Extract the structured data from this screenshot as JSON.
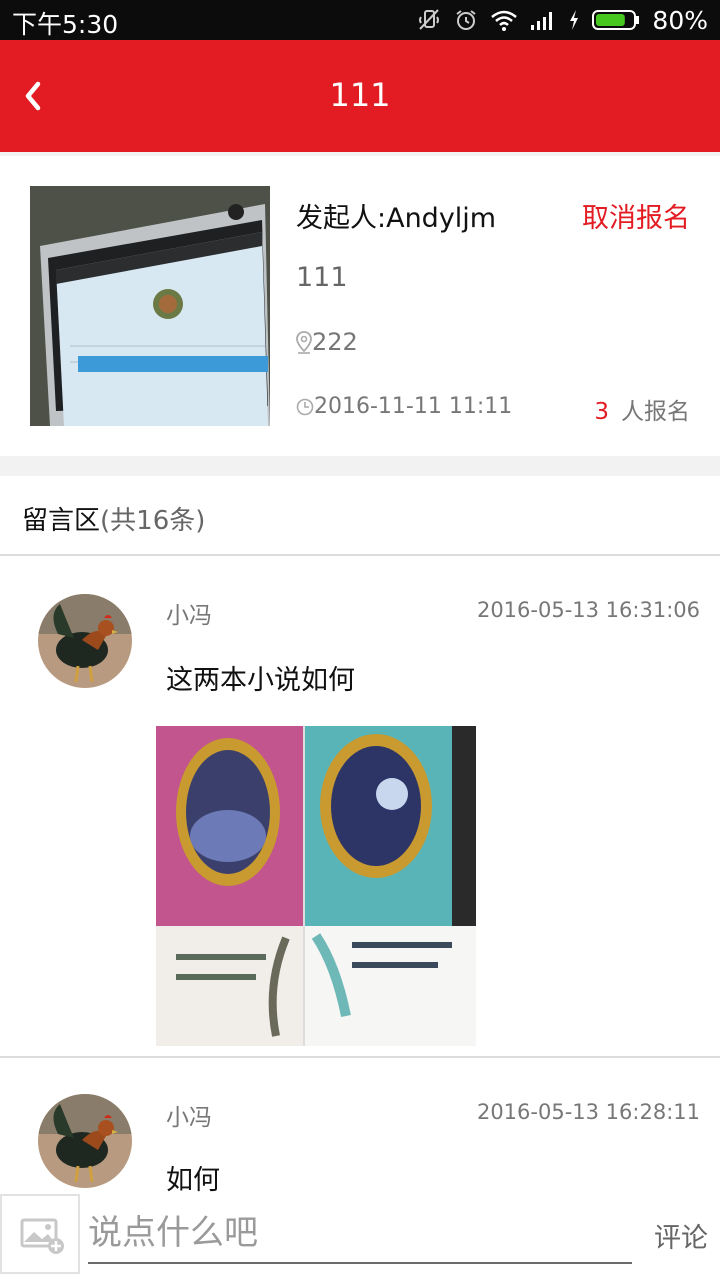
{
  "status_bar": {
    "time": "下午5:30",
    "battery_percent": "80%",
    "battery_level": 0.8,
    "icons": [
      "mute-icon",
      "alarm-icon",
      "wifi-icon",
      "signal-icon",
      "charging-icon",
      "battery-icon"
    ]
  },
  "header": {
    "title": "111",
    "back_icon": "chevron-left-icon",
    "background_color": "#e31b23"
  },
  "event": {
    "sponsor_text": "发起人:Andyljm",
    "cancel_label": "取消报名",
    "name": "111",
    "location": "222",
    "datetime": "2016-11-11 11:11",
    "signup_count": "3",
    "signup_suffix": "人报名",
    "accent_color": "#e31b23"
  },
  "comments_section": {
    "title": "留言区",
    "count_text": "(共16条)"
  },
  "comments": [
    {
      "user": "小冯",
      "time": "2016-05-13 16:31:06",
      "text": "这两本小说如何",
      "has_photo": true
    },
    {
      "user": "小冯",
      "time": "2016-05-13 16:28:11",
      "text": "如何",
      "has_photo": false
    }
  ],
  "input_bar": {
    "placeholder": "说点什么吧",
    "send_label": "评论",
    "image_button_icon": "add-image-icon"
  }
}
